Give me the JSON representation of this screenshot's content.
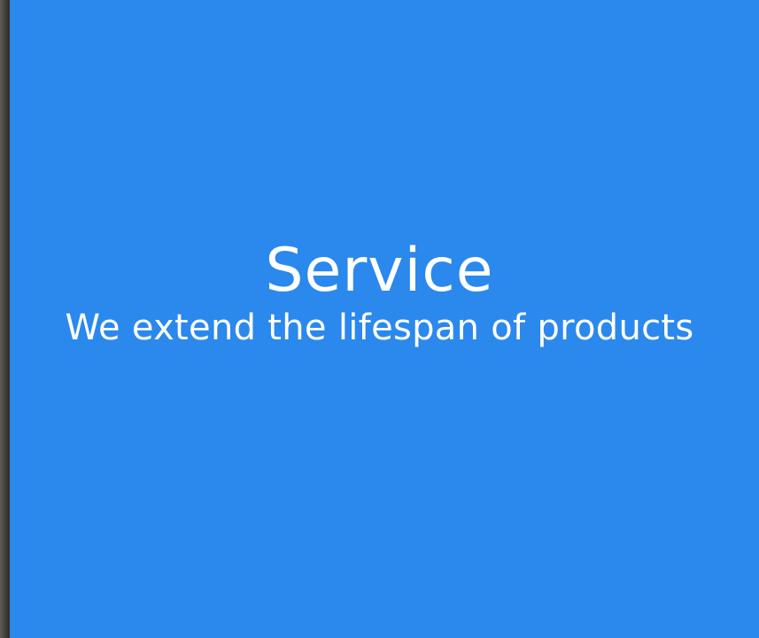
{
  "hero": {
    "title": "Service",
    "subtitle": "We extend the lifespan of products",
    "background_color": "#2b88ed",
    "text_color": "#ffffff"
  }
}
